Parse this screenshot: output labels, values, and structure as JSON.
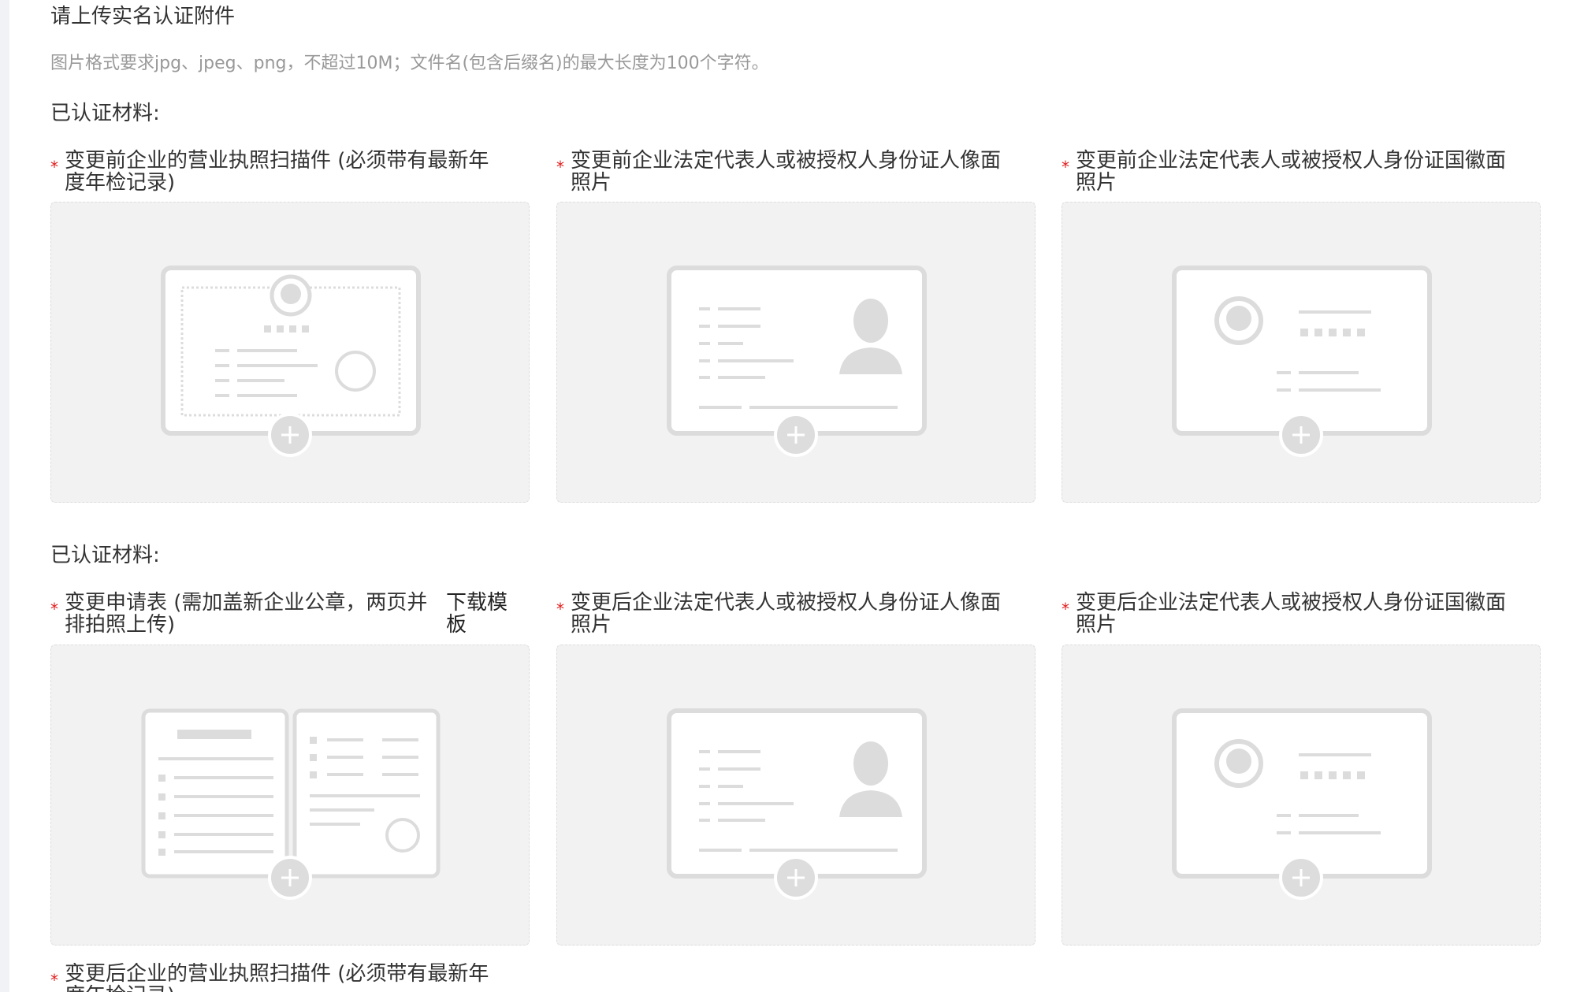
{
  "page": {
    "title": "请上传实名认证附件",
    "format_tip": "图片格式要求jpg、jpeg、png，不超过10M；文件名(包含后缀名)的最大长度为100个字符。"
  },
  "sections": [
    {
      "label": "已认证材料:",
      "items": [
        {
          "label": "变更前企业的营业执照扫描件 (必须带有最新年度年检记录)",
          "required": true,
          "icon": "business-license-icon"
        },
        {
          "label": "变更前企业法定代表人或被授权人身份证人像面照片",
          "required": true,
          "icon": "id-card-portrait-icon"
        },
        {
          "label": "变更前企业法定代表人或被授权人身份证国徽面照片",
          "required": true,
          "icon": "id-card-emblem-icon"
        }
      ]
    },
    {
      "label": "已认证材料:",
      "items": [
        {
          "label": "变更申请表 (需加盖新企业公章，两页并排拍照上传)",
          "required": true,
          "icon": "application-form-icon",
          "link": "下载模板"
        },
        {
          "label": "变更后企业法定代表人或被授权人身份证人像面照片",
          "required": true,
          "icon": "id-card-portrait-icon"
        },
        {
          "label": "变更后企业法定代表人或被授权人身份证国徽面照片",
          "required": true,
          "icon": "id-card-emblem-icon"
        }
      ]
    },
    {
      "items": [
        {
          "label": "变更后企业的营业执照扫描件 (必须带有最新年度年检记录)",
          "required": true,
          "icon": "business-license-icon"
        }
      ]
    }
  ],
  "required_mark": "*",
  "colors": {
    "required": "#e02020",
    "card_bg": "#f2f2f2",
    "illustration": "#dcdcdc",
    "tip_text": "#999999"
  }
}
